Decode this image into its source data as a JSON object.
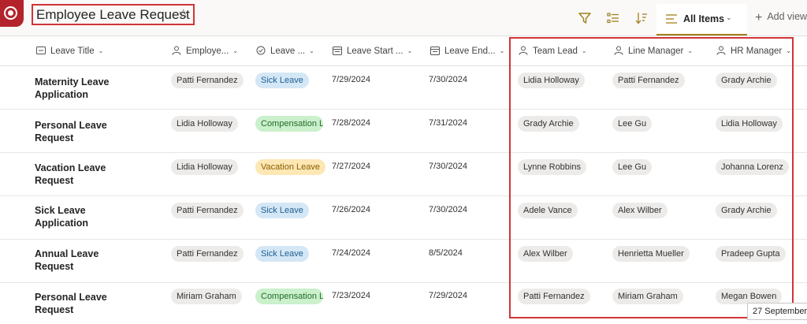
{
  "header": {
    "title": "Employee Leave Request",
    "view_label": "All Items",
    "add_view_label": "Add view"
  },
  "columns": [
    {
      "label": "Leave Title"
    },
    {
      "label": "Employe..."
    },
    {
      "label": "Leave ..."
    },
    {
      "label": "Leave Start ..."
    },
    {
      "label": "Leave End..."
    },
    {
      "label": "Team Lead"
    },
    {
      "label": "Line Manager"
    },
    {
      "label": "HR Manager"
    }
  ],
  "rows": [
    {
      "title": "Maternity Leave Application",
      "employee": "Patti Fernandez",
      "leave_type": "Sick Leave",
      "start": "7/29/2024",
      "end": "7/30/2024",
      "team_lead": "Lidia Holloway",
      "line_manager": "Patti Fernandez",
      "hr_manager": "Grady Archie"
    },
    {
      "title": "Personal Leave Request",
      "employee": "Lidia Holloway",
      "leave_type": "Compensation Le",
      "start": "7/28/2024",
      "end": "7/31/2024",
      "team_lead": "Grady Archie",
      "line_manager": "Lee Gu",
      "hr_manager": "Lidia Holloway"
    },
    {
      "title": "Vacation Leave Request",
      "employee": "Lidia Holloway",
      "leave_type": "Vacation Leave",
      "start": "7/27/2024",
      "end": "7/30/2024",
      "team_lead": "Lynne Robbins",
      "line_manager": "Lee Gu",
      "hr_manager": "Johanna Lorenz"
    },
    {
      "title": "Sick Leave Application",
      "employee": "Patti Fernandez",
      "leave_type": "Sick Leave",
      "start": "7/26/2024",
      "end": "7/30/2024",
      "team_lead": "Adele Vance",
      "line_manager": "Alex Wilber",
      "hr_manager": "Grady Archie"
    },
    {
      "title": "Annual Leave Request",
      "employee": "Patti Fernandez",
      "leave_type": "Sick Leave",
      "start": "7/24/2024",
      "end": "8/5/2024",
      "team_lead": "Alex Wilber",
      "line_manager": "Henrietta Mueller",
      "hr_manager": "Pradeep Gupta"
    },
    {
      "title": "Personal Leave Request",
      "employee": "Miriam Graham",
      "leave_type": "Compensation Le",
      "start": "7/23/2024",
      "end": "7/29/2024",
      "team_lead": "Patti Fernandez",
      "line_manager": "Miriam Graham",
      "hr_manager": "Megan Bowen"
    }
  ],
  "tooltip": {
    "text": "27 September"
  },
  "colors": {
    "accent": "#a0801b",
    "brand": "#b4232b",
    "highlight": "#d13438"
  },
  "icons": [
    "app-logo-icon",
    "star-icon",
    "filter-icon",
    "group-by-icon",
    "sort-icon",
    "view-list-icon",
    "plus-icon",
    "text-column-icon",
    "person-icon",
    "choice-icon",
    "calendar-icon",
    "chevron-down-icon"
  ]
}
